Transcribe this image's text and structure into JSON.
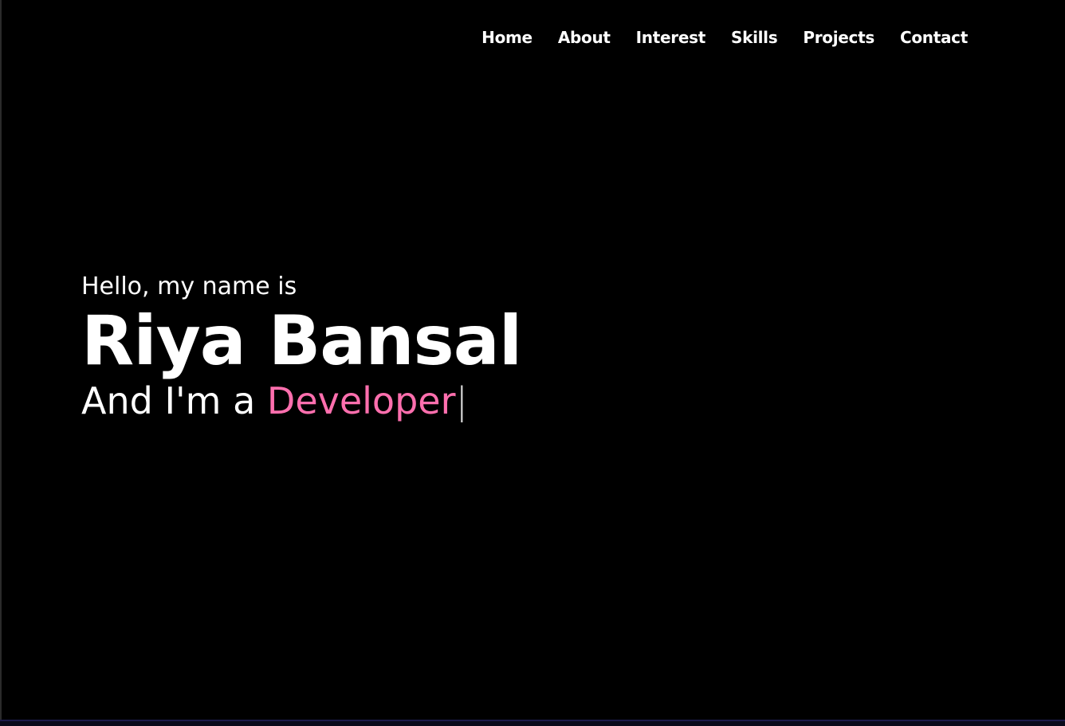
{
  "nav": {
    "items": [
      {
        "label": "Home"
      },
      {
        "label": "About"
      },
      {
        "label": "Interest"
      },
      {
        "label": "Skills"
      },
      {
        "label": "Projects"
      },
      {
        "label": "Contact"
      }
    ]
  },
  "hero": {
    "greeting": "Hello, my name is",
    "name": "Riya Bansal",
    "role_prefix": "And I'm a ",
    "role_word": "Developer",
    "cursor": "|"
  },
  "colors": {
    "background": "#000000",
    "text": "#ffffff",
    "accent": "#ff6fae"
  }
}
